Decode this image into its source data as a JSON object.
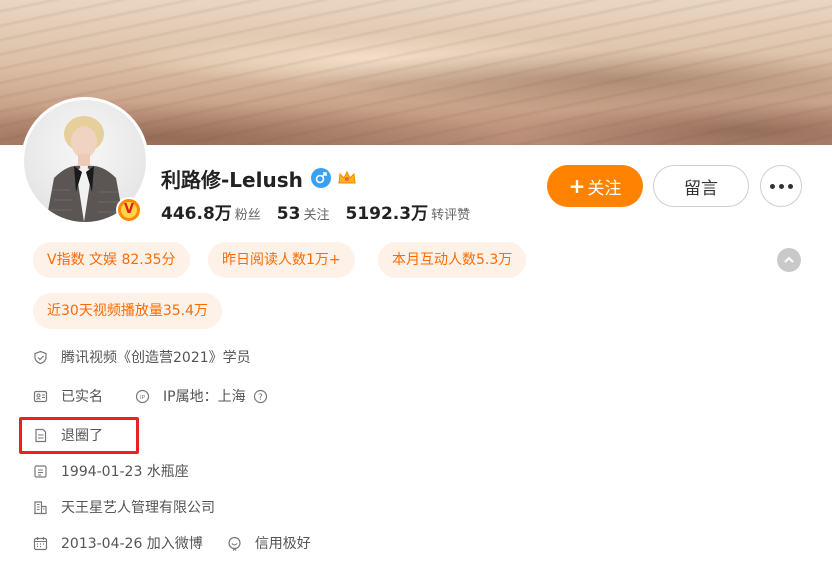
{
  "profile": {
    "name": "利路修-Lelush",
    "stats": {
      "followers_value": "446.8万",
      "followers_label": "粉丝",
      "following_value": "53",
      "following_label": "关注",
      "likes_value": "5192.3万",
      "likes_label": "转评赞"
    },
    "verified_badge": "V"
  },
  "actions": {
    "follow_plus": "+",
    "follow_label": "关注",
    "message_label": "留言"
  },
  "tags": [
    "V指数 文娱 82.35分",
    "昨日阅读人数1万+",
    "本月互动人数5.3万",
    "近30天视频播放量35.4万"
  ],
  "info": {
    "certification": "腾讯视频《创造营2021》学员",
    "real_name": "已实名",
    "ip_location": "IP属地：上海",
    "bio": "退圈了",
    "birthday": "1994-01-23 水瓶座",
    "company": "天王星艺人管理有限公司",
    "joined": "2013-04-26 加入微博",
    "credit": "信用极好"
  },
  "colors": {
    "accent": "#ff8200",
    "tag_bg": "#fdf1e8",
    "tag_text": "#ff6b00",
    "highlight": "#e8231e"
  },
  "icons": [
    "gender-male-icon",
    "crown-icon",
    "shield-icon",
    "id-card-icon",
    "ip-icon",
    "help-icon",
    "document-icon",
    "calendar-icon",
    "building-icon",
    "calendar-join-icon",
    "credit-icon",
    "chevron-up-icon",
    "more-icon"
  ]
}
